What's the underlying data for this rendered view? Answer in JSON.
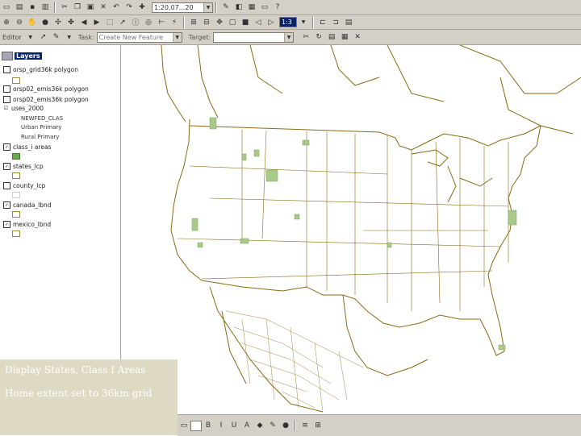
{
  "toolbar": {
    "scale_value": "1:20,07...20",
    "zoom_value": "1:3"
  },
  "editor": {
    "menu_label": "Editor",
    "task_label": "Task:",
    "task_value": "Create New Feature",
    "target_label": "Target:",
    "target_value": ""
  },
  "toc": {
    "header": "Layers",
    "layers": [
      {
        "label": "orsp_grid36k polygon",
        "checked": false
      },
      {
        "label": "orsp02_emis36k polygon",
        "checked": false
      },
      {
        "label": "orsp02_emis36k polygon",
        "checked": false
      },
      {
        "label": "uses_2000",
        "checked": true
      },
      {
        "label": "class_i areas",
        "checked": true
      },
      {
        "label": "states_lcp",
        "checked": true
      },
      {
        "label": "county_lcp",
        "checked": false
      },
      {
        "label": "canada_lbnd",
        "checked": true
      },
      {
        "label": "mexico_lbnd",
        "checked": true
      }
    ],
    "uses_categories": [
      "NEWFED_CLAS",
      "Urban Primary",
      "Rural Primary"
    ]
  },
  "caption": {
    "line1": "Display States, Class I Areas",
    "line2": "Home extent set to 36km grid"
  },
  "colors": {
    "toolbar_bg": "#d4d0c8",
    "boundary": "#8b6914",
    "class_i_fill": "#a9c98a",
    "caption_bg": "#ddd9c3"
  }
}
